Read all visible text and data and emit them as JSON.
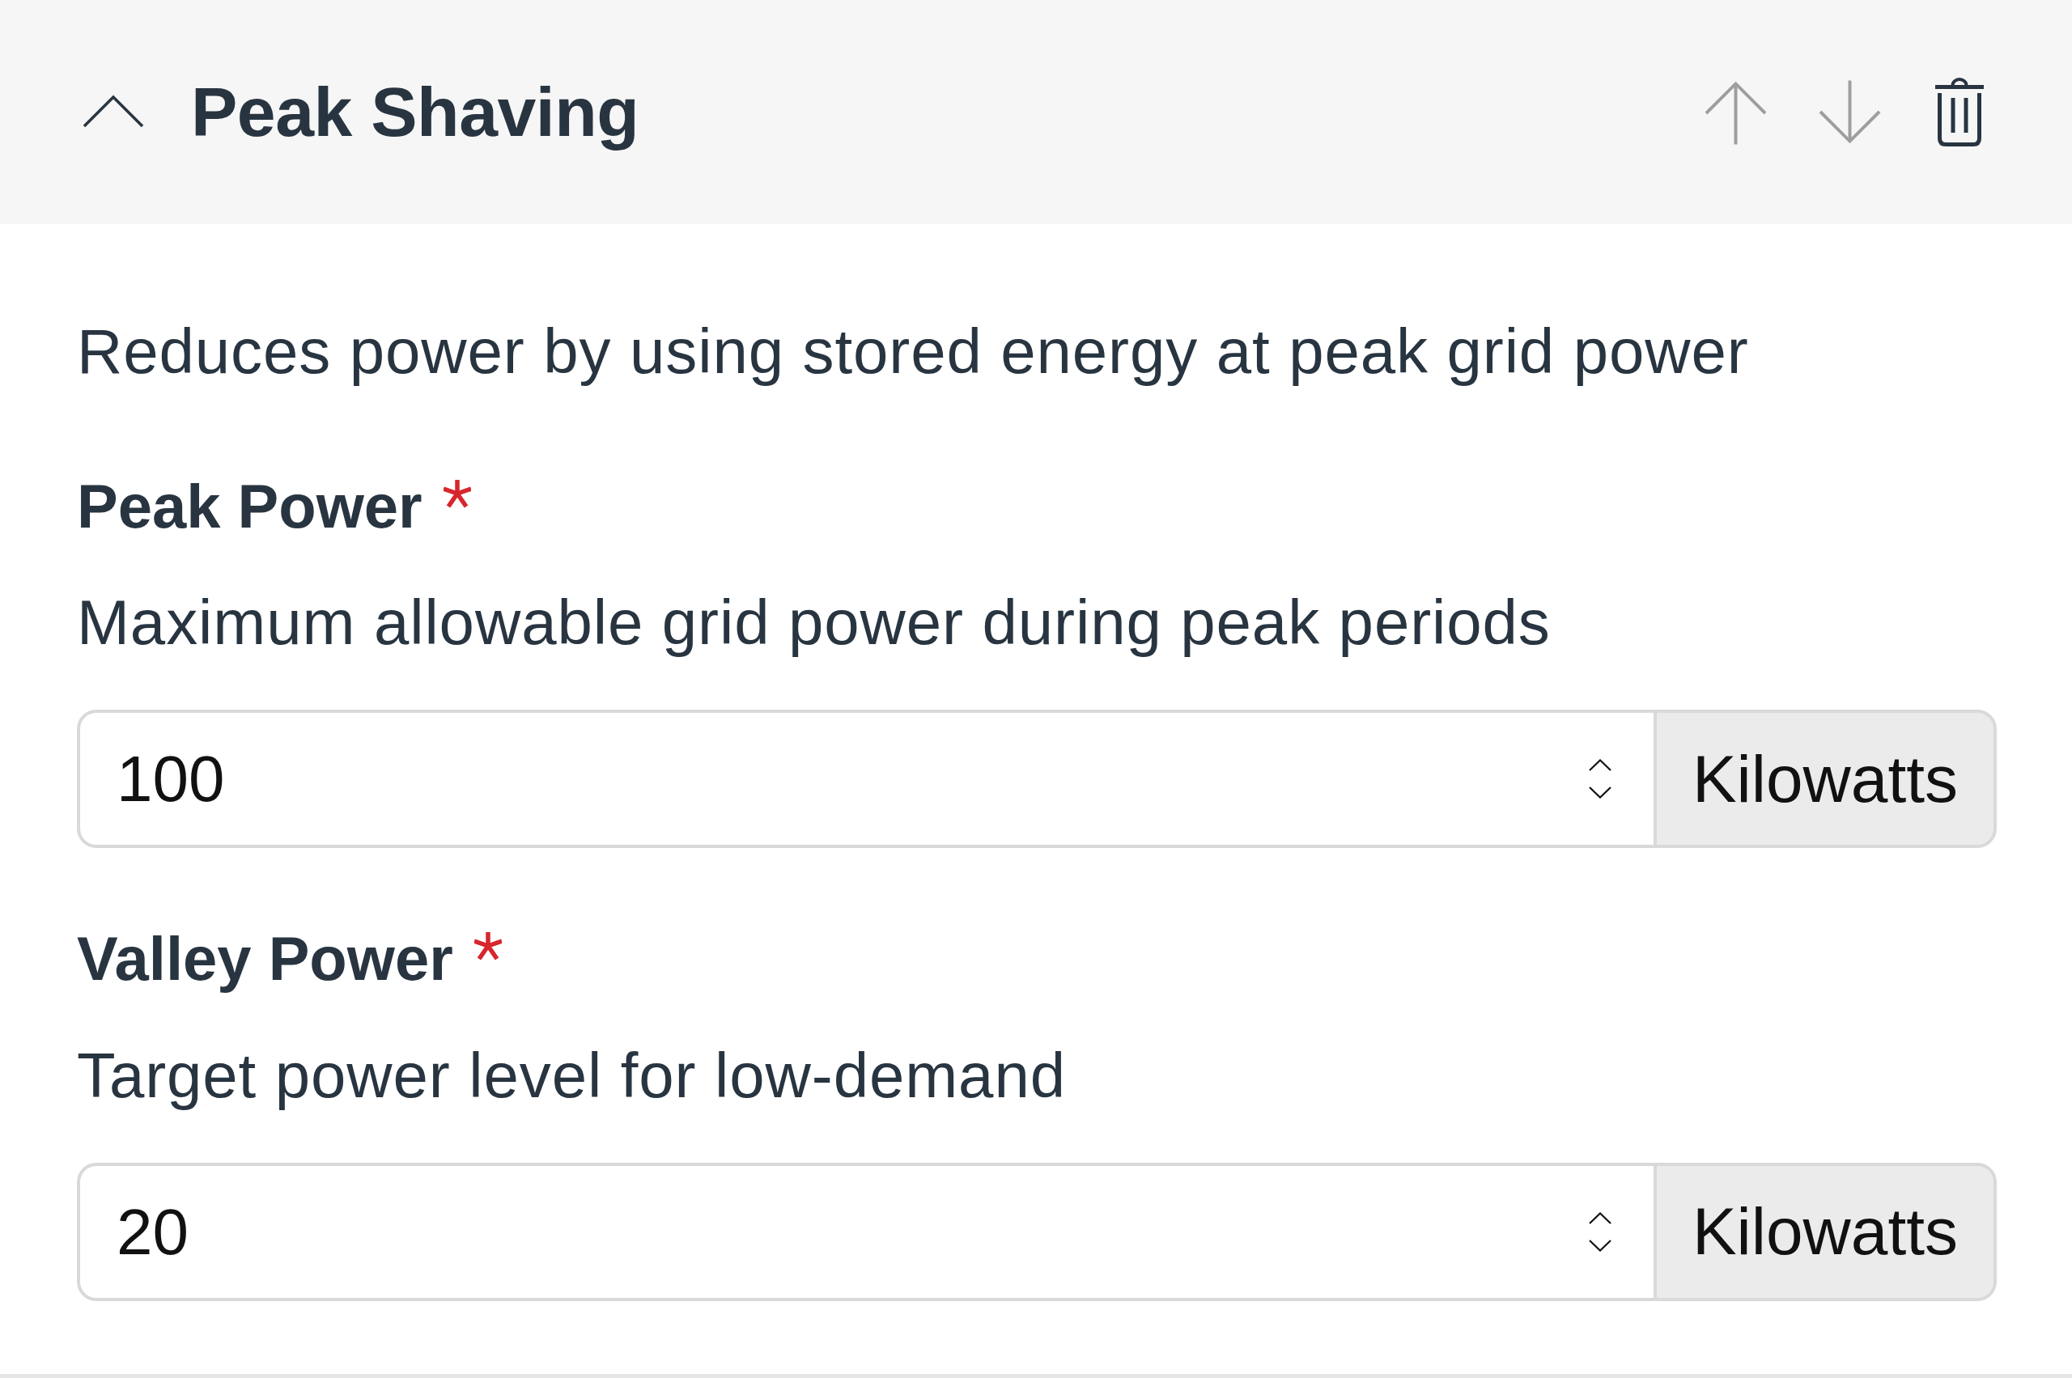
{
  "panel": {
    "title": "Peak Shaving",
    "expanded": true,
    "actions": [
      {
        "kind": "move_up",
        "disabled": true
      },
      {
        "kind": "move_down",
        "disabled": true
      },
      {
        "kind": "delete",
        "disabled": false
      }
    ],
    "description": "Reduces power by using stored energy at peak grid power",
    "fields": [
      {
        "label": "Peak Power",
        "required": true,
        "help": "Maximum allowable grid power during peak periods",
        "value": "100",
        "unit": "Kilowatts"
      },
      {
        "label": "Valley Power",
        "required": true,
        "help": "Target power level for low-demand",
        "value": "20",
        "unit": "Kilowatts"
      }
    ]
  }
}
